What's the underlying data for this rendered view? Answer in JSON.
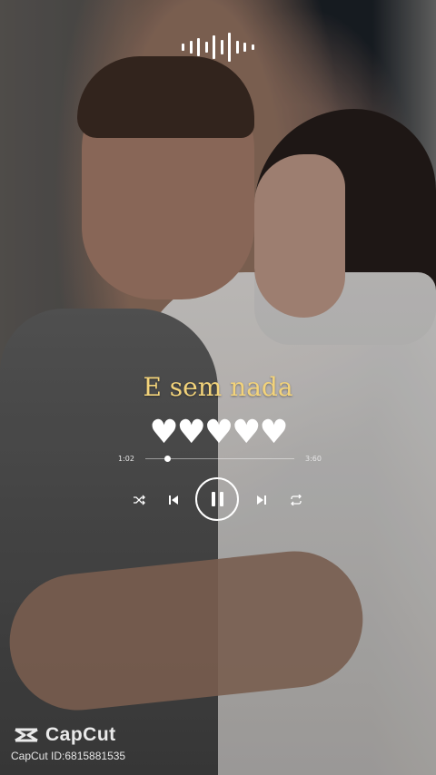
{
  "lyric": "E sem nada",
  "hearts": "♥♥♥♥♥",
  "player": {
    "current_time": "1:02",
    "total_time": "3:60",
    "progress": 0.15
  },
  "watermark": {
    "brand": "CapCut",
    "id_text": "CapCut ID:6815881535"
  },
  "icons": {
    "waveform": "audio-waveform-icon",
    "shuffle": "shuffle-icon",
    "previous": "skip-previous-icon",
    "pause": "pause-icon",
    "next": "skip-next-icon",
    "repeat": "repeat-icon"
  }
}
